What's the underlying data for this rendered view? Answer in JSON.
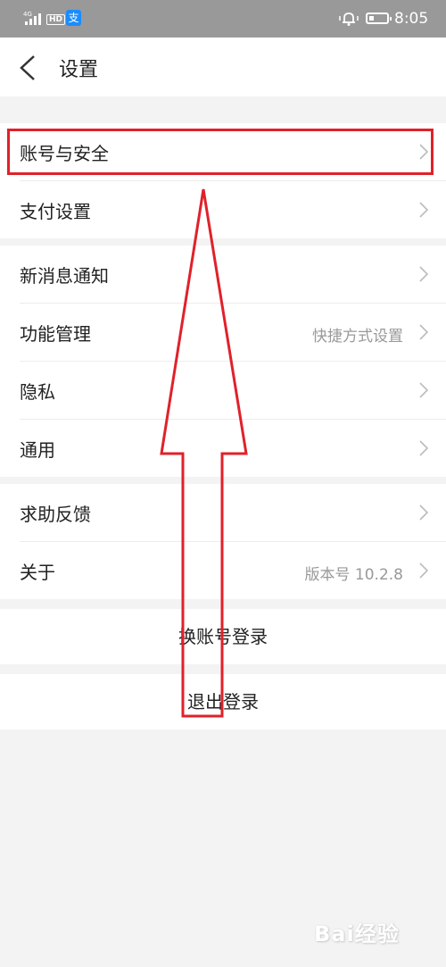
{
  "status_bar": {
    "network": "4G",
    "hd": "HD",
    "time": "8:05"
  },
  "header": {
    "title": "设置"
  },
  "groups": [
    {
      "items": [
        {
          "label": "账号与安全"
        },
        {
          "label": "支付设置"
        }
      ]
    },
    {
      "items": [
        {
          "label": "新消息通知"
        },
        {
          "label": "功能管理",
          "value": "快捷方式设置"
        },
        {
          "label": "隐私"
        },
        {
          "label": "通用"
        }
      ]
    },
    {
      "items": [
        {
          "label": "求助反馈"
        },
        {
          "label": "关于",
          "value": "版本号 10.2.8"
        }
      ]
    }
  ],
  "actions": {
    "switch_account": "换账号登录",
    "logout": "退出登录"
  },
  "watermark": "Bai经验",
  "colors": {
    "annotation": "#e0212a",
    "status_bar": "#999999",
    "background": "#f3f3f3"
  }
}
